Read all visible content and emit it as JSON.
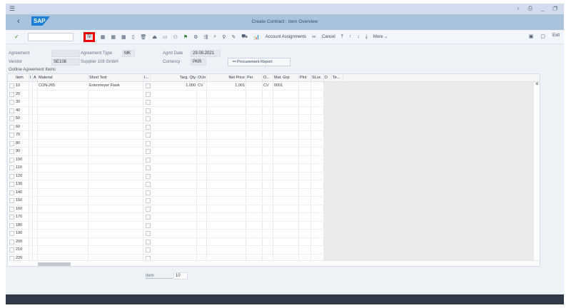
{
  "window": {
    "title": "Create Contract : Item Overview",
    "controls": "‹ ⎙ _ ❐"
  },
  "toolbar": {
    "more": "More",
    "account_assignments": "Account Assignments",
    "cancel": "Cancel",
    "exit": "Exit",
    "command_value": ""
  },
  "header": {
    "agreement_label": "Agreement",
    "agreement_value": "",
    "type_label": "Agreement Type",
    "type_value": "MK",
    "date_label": "Agmt Date",
    "date_value": "29.09.2021",
    "vendor_label": "Vendor",
    "vendor_value": "SE108",
    "vendor_name": "Supplier 108 GmbH",
    "currency_label": "Currency",
    "currency_value": "PKR",
    "procurement_report": "Procurement Report"
  },
  "section_title": "Outline Agreement Items",
  "table": {
    "columns": [
      "Item",
      "I",
      "A",
      "Material",
      "Short Text",
      "I...",
      "Targ. Qty",
      "OUn",
      "Net Price",
      "Per",
      "O...",
      "Mat. Grp",
      "Plnt",
      "SLoc",
      "D",
      "Te..."
    ],
    "first_row": {
      "item": "10",
      "material": "CON-265",
      "short_text": "Erlenmeyer Flask",
      "targ_qty": "1.000",
      "oun": "CV",
      "net_price": "1,001",
      "oprice_unit": "CV",
      "mat_grp": "0001"
    },
    "items": [
      "20",
      "30",
      "40",
      "50",
      "60",
      "70",
      "80",
      "90",
      "100",
      "110",
      "120",
      "130",
      "140",
      "150",
      "160",
      "170",
      "180",
      "190",
      "200",
      "210",
      "220"
    ]
  },
  "item_field": {
    "label": "Item",
    "value": "10"
  }
}
